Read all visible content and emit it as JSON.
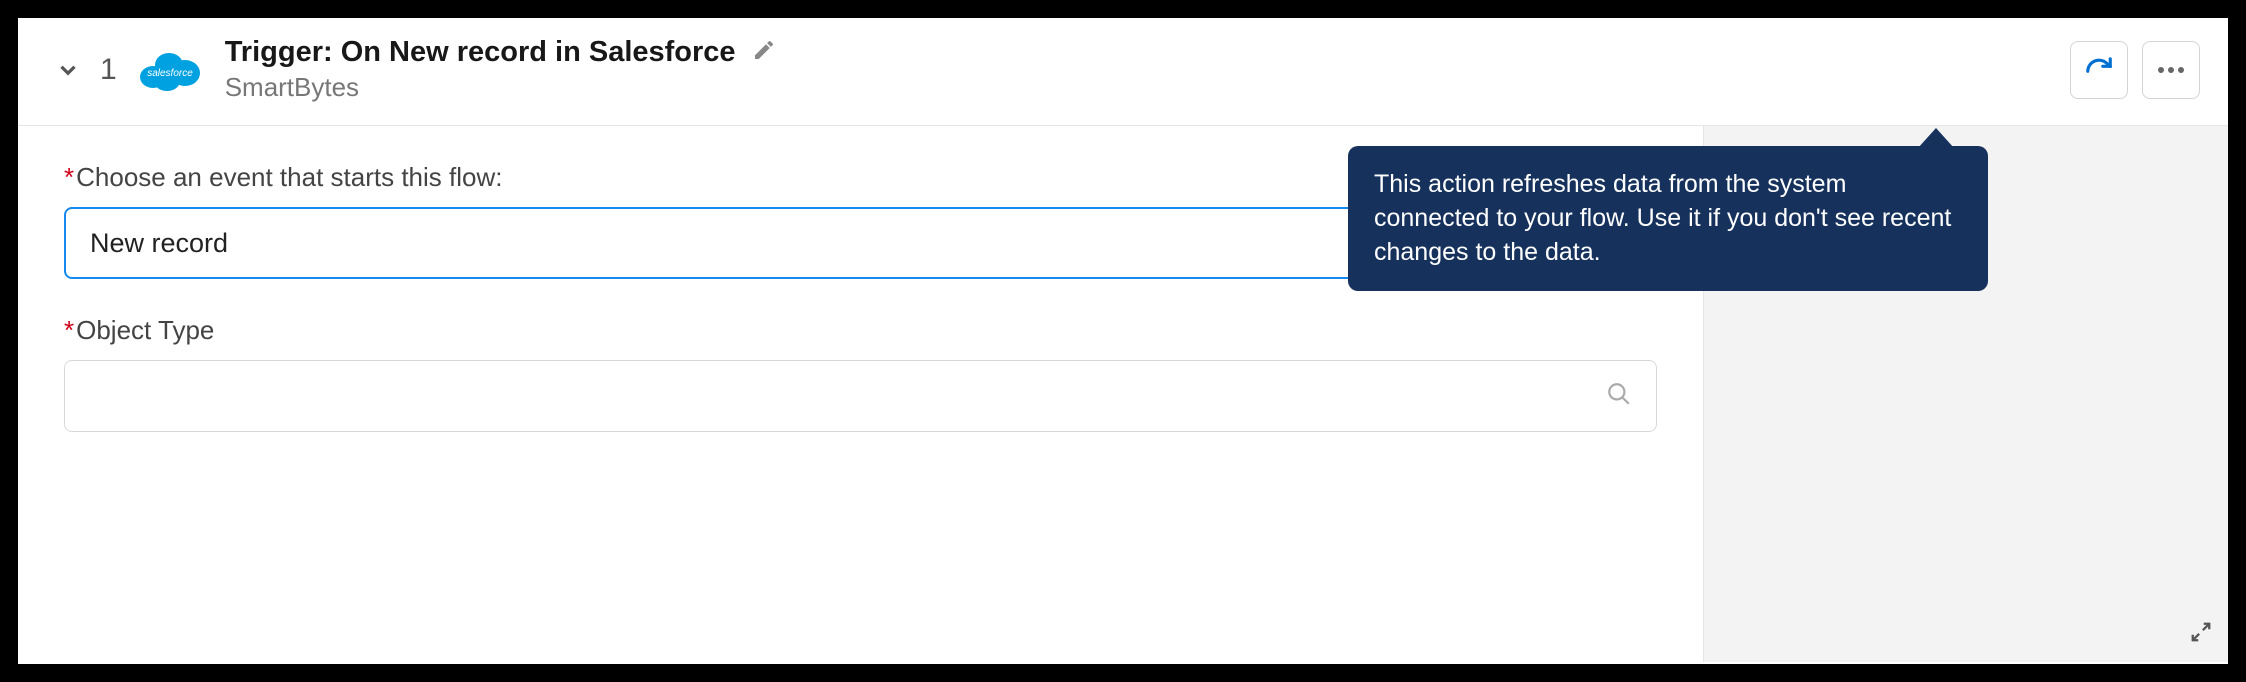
{
  "header": {
    "step_number": "1",
    "title": "Trigger: On New record in Salesforce",
    "subtitle": "SmartBytes"
  },
  "form": {
    "event_label": "Choose an event that starts this flow:",
    "event_value": "New record",
    "object_label": "Object Type",
    "object_value": ""
  },
  "tooltip": {
    "text": "This action refreshes data from the system connected to your flow. Use it if you don't see recent changes to the data."
  }
}
